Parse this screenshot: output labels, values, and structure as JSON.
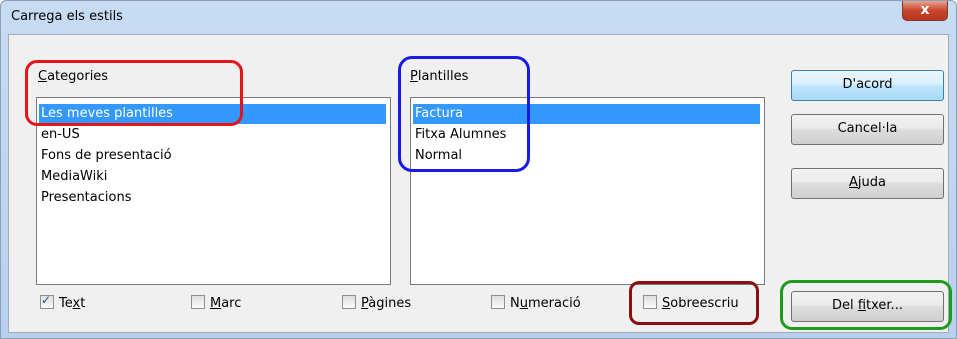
{
  "window": {
    "title": "Carrega els estils",
    "close_glyph": "x"
  },
  "categories": {
    "label_u": "C",
    "label_rest": "ategories",
    "items": [
      "Les meves plantilles",
      "en-US",
      "Fons de presentació",
      "MediaWiki",
      "Presentacions"
    ],
    "selected": "Les meves plantilles"
  },
  "templates": {
    "label_u": "P",
    "label_rest": "lantilles",
    "items": [
      "Factura",
      "Fitxa Alumnes",
      "Normal"
    ],
    "selected": "Factura"
  },
  "buttons": {
    "ok": "D'acord",
    "cancel": "Cancel·la",
    "help_u": "A",
    "help_rest": "juda",
    "from_file_pre": "Del ",
    "from_file_u": "f",
    "from_file_rest": "itxer..."
  },
  "checkboxes": {
    "text": {
      "pre": "Te",
      "u": "x",
      "post": "t",
      "checked": true
    },
    "frame": {
      "pre": "",
      "u": "M",
      "post": "arc",
      "checked": false
    },
    "pages": {
      "pre": "",
      "u": "P",
      "post": "àgines",
      "checked": false
    },
    "numbering": {
      "pre": "N",
      "u": "u",
      "post": "meració",
      "checked": false
    },
    "overwrite": {
      "pre": "",
      "u": "S",
      "post": "obreescriu",
      "checked": false
    }
  },
  "colors": {
    "selection": "#3399ff",
    "annot_red": "#e8141a",
    "annot_blue": "#1a1ae6",
    "annot_darkred": "#8b0f0f",
    "annot_green": "#1e9b1e"
  }
}
